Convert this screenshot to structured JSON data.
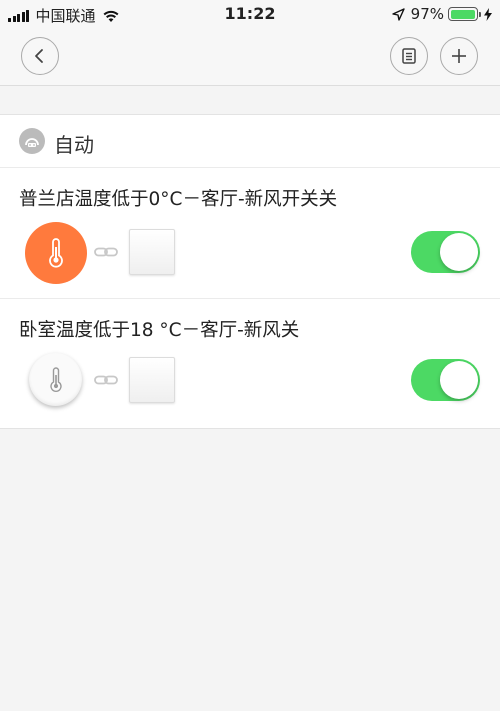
{
  "status_bar": {
    "carrier": "中国联通",
    "time": "11:22",
    "battery_percent": "97%",
    "battery_level": 0.97,
    "icons": [
      "signal-icon",
      "wifi-icon",
      "location-arrow-icon",
      "battery-icon",
      "charging-icon"
    ]
  },
  "nav": {
    "back_icon": "chevron-left-icon",
    "log_icon": "log-list-icon",
    "add_icon": "plus-icon"
  },
  "section": {
    "title": "自动",
    "icon": "automation-icon"
  },
  "rules": [
    {
      "title": "普兰店温度低于0°C－客厅-新风开关关",
      "sensor_icon": "thermometer-icon",
      "sensor_style": "orange",
      "link_icon": "link-icon",
      "target_device": "wall-switch",
      "enabled": true
    },
    {
      "title": "卧室温度低于18 °C－客厅-新风关",
      "sensor_icon": "thermometer-icon",
      "sensor_style": "white",
      "link_icon": "link-icon",
      "target_device": "wall-switch",
      "enabled": true
    }
  ],
  "colors": {
    "toggle_on": "#4cd964",
    "sensor_orange": "#ff7a3d",
    "battery": "#4cd964",
    "background": "#f4f4f4"
  }
}
